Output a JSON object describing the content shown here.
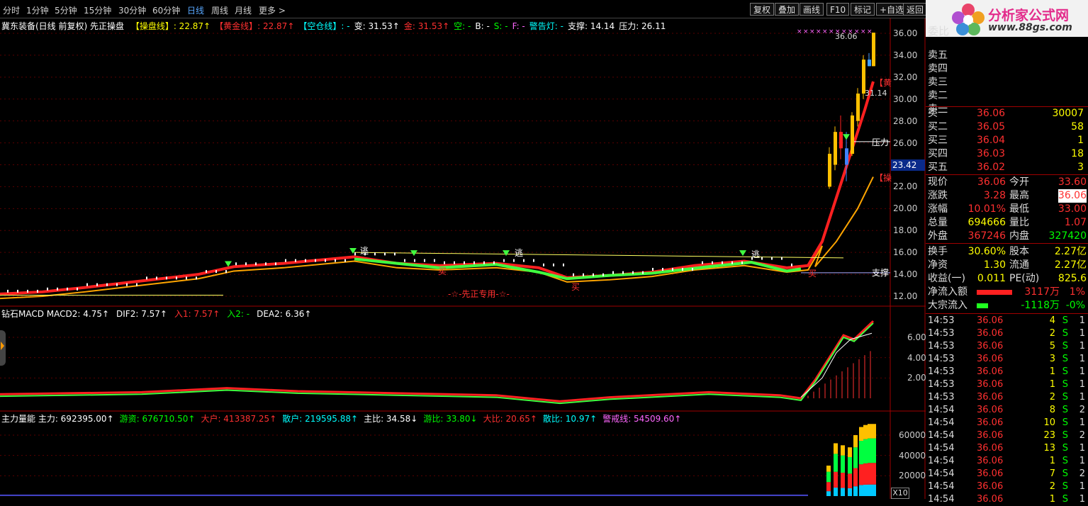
{
  "toolbar": {
    "tabs": [
      "分时",
      "1分钟",
      "5分钟",
      "15分钟",
      "30分钟",
      "60分钟",
      "日线",
      "周线",
      "月线",
      "更多 >"
    ],
    "active_tab": "日线",
    "buttons": [
      "复权",
      "叠加",
      "画线",
      "F10",
      "标记",
      "+自选",
      "返回"
    ]
  },
  "logo": {
    "title": "分析家公式网",
    "url": "www.88gs.com"
  },
  "price_panel": {
    "header_stock": "冀东装备(日线 前复权) 先正操盘",
    "header_items": [
      {
        "label": "【操盘线】",
        "value": ": 22.87",
        "arrow": "↑",
        "color": "#ffff00"
      },
      {
        "label": "【黄金线】",
        "value": ": 22.87",
        "arrow": "↑",
        "color": "#ff3030"
      },
      {
        "label": "【空仓线】",
        "value": ": -",
        "arrow": "",
        "color": "#00ffff"
      },
      {
        "label": "变",
        "value": ": 31.53",
        "arrow": "↑",
        "color": "#ffffff"
      },
      {
        "label": "金",
        "value": ": 31.53",
        "arrow": "↑",
        "color": "#ff3030"
      },
      {
        "label": "空",
        "value": ": -",
        "arrow": "",
        "color": "#00ff00"
      },
      {
        "label": "B",
        "value": ": -",
        "arrow": "",
        "color": "#ffffff"
      },
      {
        "label": "S",
        "value": ": -",
        "arrow": "",
        "color": "#00ff00"
      },
      {
        "label": "F",
        "value": ": -",
        "arrow": "",
        "color": "#ff66ff"
      },
      {
        "label": "警告灯",
        "value": ": -",
        "arrow": "",
        "color": "#00ffff"
      },
      {
        "label": "支撑",
        "value": ": 14.14",
        "arrow": "",
        "color": "#ffffff"
      },
      {
        "label": "压力",
        "value": ": 26.11",
        "arrow": "",
        "color": "#ffffff"
      }
    ],
    "y_ticks": [
      "36.00",
      "34.00",
      "32.00",
      "30.00",
      "28.00",
      "26.00",
      "24.00",
      "22.00",
      "20.00",
      "18.00",
      "16.00",
      "14.00",
      "12.00"
    ],
    "cursor_price": "23.42",
    "annotations": {
      "high": "36.06",
      "level": "31.14",
      "pressure": "压力",
      "support": "支撑",
      "escape": "逃",
      "buy": "买",
      "watermark": "-☆-先正专用-☆-",
      "tag_red1": "【黄",
      "tag_red2": "【操"
    }
  },
  "macd_panel": {
    "items": [
      {
        "text": "钻石MACD  MACD2: 4.75",
        "arrow": "↑",
        "color": "#ffffff"
      },
      {
        "text": "DIF2: 7.57",
        "arrow": "↑",
        "color": "#ffffff"
      },
      {
        "text": "入1: 7.57",
        "arrow": "↑",
        "color": "#ff3030"
      },
      {
        "text": "入2: -",
        "arrow": "",
        "color": "#00ff00"
      },
      {
        "text": "DEA2: 6.36",
        "arrow": "↑",
        "color": "#ffffff"
      }
    ],
    "y_ticks": [
      "6.00",
      "4.00",
      "2.00"
    ]
  },
  "vol_panel": {
    "items": [
      {
        "text": "主力量能  主力: 692395.00",
        "arrow": "↑",
        "color": "#ffffff"
      },
      {
        "text": "游资: 676710.50",
        "arrow": "↑",
        "color": "#00ff00"
      },
      {
        "text": "大户: 413387.25",
        "arrow": "↑",
        "color": "#ff3030"
      },
      {
        "text": "散户: 219595.88",
        "arrow": "↑",
        "color": "#00ffff"
      },
      {
        "text": "主比: 34.58",
        "arrow": "↓",
        "color": "#ffffff"
      },
      {
        "text": "游比: 33.80",
        "arrow": "↓",
        "color": "#00ff00"
      },
      {
        "text": "大比: 20.65",
        "arrow": "↑",
        "color": "#ff3030"
      },
      {
        "text": "散比: 10.97",
        "arrow": "↑",
        "color": "#00ffff"
      },
      {
        "text": "警戒线: 54509.60",
        "arrow": "↑",
        "color": "#ff66ff"
      }
    ],
    "y_ticks": [
      "60000",
      "40000",
      "20000"
    ],
    "scale": "X10"
  },
  "quote": {
    "weibi": "委比",
    "sells": [
      {
        "label": "卖五",
        "price": "",
        "vol": ""
      },
      {
        "label": "卖四",
        "price": "",
        "vol": ""
      },
      {
        "label": "卖三",
        "price": "",
        "vol": ""
      },
      {
        "label": "卖二",
        "price": "",
        "vol": ""
      },
      {
        "label": "卖一",
        "price": "",
        "vol": ""
      }
    ],
    "buys": [
      {
        "label": "买一",
        "price": "36.06",
        "vol": "30007"
      },
      {
        "label": "买二",
        "price": "36.05",
        "vol": "58"
      },
      {
        "label": "买三",
        "price": "36.04",
        "vol": "1"
      },
      {
        "label": "买四",
        "price": "36.03",
        "vol": "18"
      },
      {
        "label": "买五",
        "price": "36.02",
        "vol": "3"
      }
    ],
    "stats": [
      {
        "l1": "现价",
        "v1": "36.06",
        "c1": "#ff3030",
        "l2": "今开",
        "v2": "33.60",
        "c2": "#ff3030",
        "bg2": ""
      },
      {
        "l1": "涨跌",
        "v1": "3.28",
        "c1": "#ff3030",
        "l2": "最高",
        "v2": "36.06",
        "c2": "#ff3030",
        "bg2": "#ffffff"
      },
      {
        "l1": "涨幅",
        "v1": "10.01%",
        "c1": "#ff3030",
        "l2": "最低",
        "v2": "33.00",
        "c2": "#ff3030",
        "bg2": ""
      },
      {
        "l1": "总量",
        "v1": "694666",
        "c1": "#ffff00",
        "l2": "量比",
        "v2": "1.07",
        "c2": "#ff3030",
        "bg2": ""
      },
      {
        "l1": "外盘",
        "v1": "367246",
        "c1": "#ff3030",
        "l2": "内盘",
        "v2": "327420",
        "c2": "#00ff00",
        "bg2": ""
      },
      {
        "l1": "换手",
        "v1": "30.60%",
        "c1": "#ffff00",
        "l2": "股本",
        "v2": "2.27亿",
        "c2": "#ffff00",
        "bg2": ""
      },
      {
        "l1": "净资",
        "v1": "1.30",
        "c1": "#ffff00",
        "l2": "流通",
        "v2": "2.27亿",
        "c2": "#ffff00",
        "bg2": ""
      },
      {
        "l1": "收益(一)",
        "v1": "0.011",
        "c1": "#ffff00",
        "l2": "PE(动)",
        "v2": "825.6",
        "c2": "#ffff00",
        "bg2": ""
      }
    ],
    "net_inflow": {
      "label": "净流入额",
      "value": "3117万",
      "pct": "1%"
    },
    "block_inflow": {
      "label": "大宗流入",
      "value": "-1118万",
      "pct": "-0%"
    }
  },
  "ticks": [
    {
      "time": "14:53",
      "price": "36.06",
      "vol": "4",
      "side": "S",
      "n": "1"
    },
    {
      "time": "14:53",
      "price": "36.06",
      "vol": "2",
      "side": "S",
      "n": "1"
    },
    {
      "time": "14:53",
      "price": "36.06",
      "vol": "5",
      "side": "S",
      "n": "1"
    },
    {
      "time": "14:53",
      "price": "36.06",
      "vol": "3",
      "side": "S",
      "n": "1"
    },
    {
      "time": "14:53",
      "price": "36.06",
      "vol": "1",
      "side": "S",
      "n": "1"
    },
    {
      "time": "14:53",
      "price": "36.06",
      "vol": "1",
      "side": "S",
      "n": "1"
    },
    {
      "time": "14:53",
      "price": "36.06",
      "vol": "2",
      "side": "S",
      "n": "1"
    },
    {
      "time": "14:54",
      "price": "36.06",
      "vol": "8",
      "side": "S",
      "n": "2"
    },
    {
      "time": "14:54",
      "price": "36.06",
      "vol": "10",
      "side": "S",
      "n": "1"
    },
    {
      "time": "14:54",
      "price": "36.06",
      "vol": "23",
      "side": "S",
      "n": "2"
    },
    {
      "time": "14:54",
      "price": "36.06",
      "vol": "13",
      "side": "S",
      "n": "1"
    },
    {
      "time": "14:54",
      "price": "36.06",
      "vol": "1",
      "side": "S",
      "n": "1"
    },
    {
      "time": "14:54",
      "price": "36.06",
      "vol": "7",
      "side": "S",
      "n": "2"
    },
    {
      "time": "14:54",
      "price": "36.06",
      "vol": "2",
      "side": "S",
      "n": "1"
    },
    {
      "time": "14:54",
      "price": "36.06",
      "vol": "1",
      "side": "S",
      "n": "1"
    }
  ],
  "colors": {
    "up": "#ff3030",
    "down": "#00ff00",
    "grid": "#7a0000",
    "accent": "#59a8ff"
  }
}
